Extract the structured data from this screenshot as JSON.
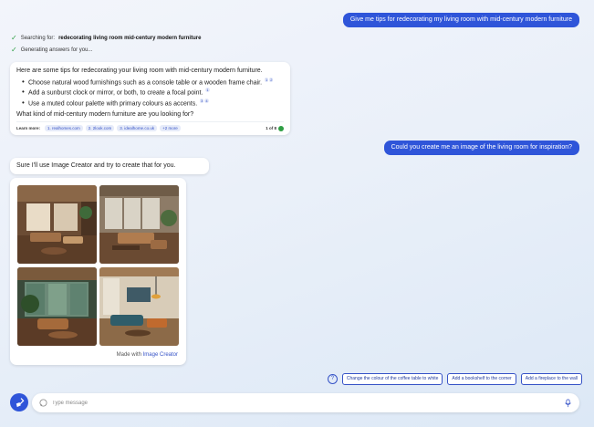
{
  "chat": {
    "user_message_1": "Give me tips for redecorating my living room with mid-century modern furniture",
    "status": {
      "searching_label": "Searching for:",
      "searching_query": "redecorating living room mid-century modern furniture",
      "generating": "Generating answers for you..."
    },
    "answer": {
      "intro": "Here are some tips for redecorating your living room with mid-century modern furniture.",
      "tips": [
        {
          "text": "Choose natural wood furnishings such as a console table or a wooden frame chair.",
          "cites": [
            "1",
            "2"
          ]
        },
        {
          "text": "Add a sunburst clock or mirror, or both, to create a focal point.",
          "cites": [
            "1"
          ]
        },
        {
          "text": "Use a muted colour palette with primary colours as accents.",
          "cites": [
            "3",
            "4"
          ]
        }
      ],
      "question": "What kind of mid-century modern furniture are you looking for?",
      "learn_more_label": "Learn more:",
      "sources": [
        "1. realhomes.com",
        "2. 2look.com",
        "3. idealhome.co.uk",
        "+2 more"
      ],
      "page_count": "1 of 8"
    },
    "user_message_2": "Could you create me an image of the living room for inspiration?",
    "reply": "Sure I'll use Image Creator and try to create that for you.",
    "made_with_prefix": "Made with",
    "made_with_link": "Image Creator"
  },
  "suggestions": [
    "Change the colour of the coffee table to white",
    "Add a bookshelf to the corner",
    "Add a fireplace to the wall"
  ],
  "input": {
    "placeholder": "Type message"
  },
  "colors": {
    "accent": "#2f55d9",
    "link": "#3653c7",
    "success": "#2f9e44"
  },
  "icons": [
    "check-icon",
    "broom-icon",
    "chat-bubble-icon",
    "microphone-icon",
    "help-icon"
  ]
}
